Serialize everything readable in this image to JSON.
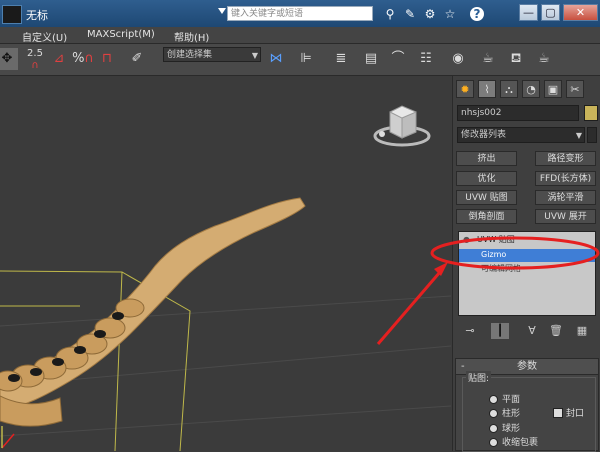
{
  "titlebar": {
    "title": "无标",
    "search_placeholder": "键入关键字或短语",
    "icons": [
      "binoculars-icon",
      "tools-icon",
      "star-icon",
      "help-icon"
    ],
    "window_buttons": [
      "—",
      "▢",
      "✕"
    ]
  },
  "menu": [
    "自定义(U)",
    "MAXScript(M)",
    "帮助(H)"
  ],
  "toolbar": {
    "snap_value": "2.5",
    "selection_set": "创建选择集",
    "percent_symbol": "%"
  },
  "panel": {
    "tabs": [
      "create-icon",
      "modify-icon",
      "hierarchy-icon",
      "motion-icon",
      "display-icon",
      "utilities-icon"
    ],
    "object_name": "nhsjs002",
    "modifier_list": "修改器列表",
    "buttons": [
      [
        "挤出",
        "路径变形"
      ],
      [
        "优化",
        "FFD(长方体)"
      ],
      [
        "UVW 贴图",
        "涡轮平滑"
      ],
      [
        "倒角剖面",
        "UVW 展开"
      ]
    ],
    "stack": {
      "item_uvw": "UVW 贴图",
      "item_gizmo": "Gizmo",
      "item_base": "可编辑网格"
    },
    "params": {
      "header": "参数",
      "group_label": "贴图:",
      "options": [
        "平面",
        "柱形",
        "球形",
        "收缩包裹"
      ],
      "cap_label": "封口"
    }
  },
  "colors": {
    "highlight_ellipse": "#e52020",
    "arrow": "#e52020",
    "selection_blue": "#3f7ed6",
    "bone_wood": "#d4ac72",
    "gizmo_yellow": "#bfb84a"
  }
}
